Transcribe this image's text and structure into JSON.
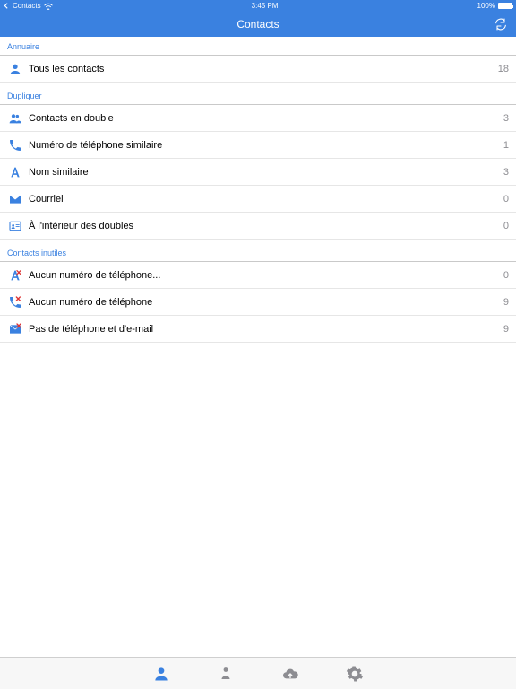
{
  "status": {
    "back_app": "Contacts",
    "time": "3:45 PM",
    "battery": "100%"
  },
  "nav": {
    "title": "Contacts"
  },
  "sections": [
    {
      "header": "Annuaire",
      "rows": [
        {
          "icon": "person-icon",
          "label": "Tous les contacts",
          "count": "18"
        }
      ]
    },
    {
      "header": "Dupliquer",
      "rows": [
        {
          "icon": "people-icon",
          "label": "Contacts en double",
          "count": "3"
        },
        {
          "icon": "phone-icon",
          "label": "Numéro de téléphone similaire",
          "count": "1"
        },
        {
          "icon": "letter-a-icon",
          "label": "Nom similaire",
          "count": "3"
        },
        {
          "icon": "envelope-icon",
          "label": "Courriel",
          "count": "0"
        },
        {
          "icon": "card-icon",
          "label": "À l'intérieur des doubles",
          "count": "0"
        }
      ]
    },
    {
      "header": "Contacts inutiles",
      "rows": [
        {
          "icon": "letter-a-x-icon",
          "label": "Aucun numéro de téléphone...",
          "count": "0"
        },
        {
          "icon": "phone-x-icon",
          "label": "Aucun numéro de téléphone",
          "count": "9"
        },
        {
          "icon": "envelope-x-icon",
          "label": "Pas de téléphone et d'e-mail",
          "count": "9"
        }
      ]
    }
  ],
  "tabs": {
    "contacts": "contacts-tab",
    "favorites": "favorites-tab",
    "cloud": "cloud-tab",
    "settings": "settings-tab"
  }
}
